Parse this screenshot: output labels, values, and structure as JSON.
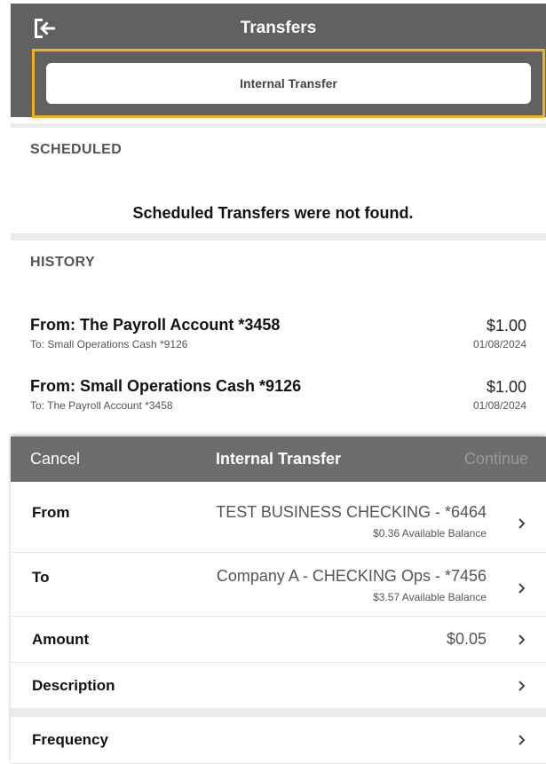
{
  "header": {
    "title": "Transfers",
    "exit_icon": "exit-arrow-icon",
    "internal_transfer_button": "Internal Transfer"
  },
  "scheduled": {
    "heading": "SCHEDULED",
    "empty_message": "Scheduled Transfers were not found."
  },
  "history": {
    "heading": "HISTORY",
    "items": [
      {
        "from": "From: The Payroll Account *3458",
        "to": "To: Small Operations Cash *9126",
        "amount": "$1.00",
        "date": "01/08/2024"
      },
      {
        "from": "From: Small Operations Cash *9126",
        "to": "To: The Payroll Account *3458",
        "amount": "$1.00",
        "date": "01/08/2024"
      }
    ]
  },
  "sheet": {
    "cancel": "Cancel",
    "title": "Internal Transfer",
    "continue": "Continue",
    "rows": {
      "from": {
        "label": "From",
        "value": "TEST BUSINESS CHECKING - *6464",
        "sub": "$0.36 Available Balance"
      },
      "to": {
        "label": "To",
        "value": "Company A - CHECKING Ops - *7456",
        "sub": "$3.57 Available Balance"
      },
      "amount": {
        "label": "Amount",
        "value": "$0.05"
      },
      "description": {
        "label": "Description",
        "value": ""
      },
      "frequency": {
        "label": "Frequency",
        "value": ""
      }
    }
  },
  "colors": {
    "header_bg": "#616161",
    "sheet_header_bg": "#6d6d6d",
    "highlight": "#f2b01e",
    "section_divider": "#ebebeb"
  }
}
